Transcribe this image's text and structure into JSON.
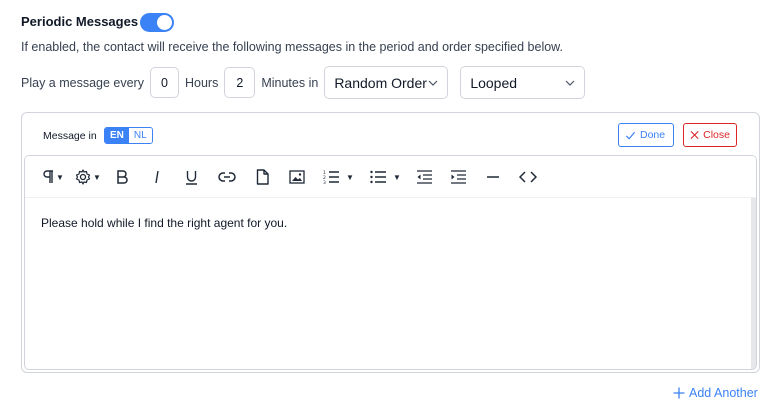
{
  "settings": {
    "title": "Periodic Messages",
    "enabled": true,
    "description": "If enabled, the contact will receive the following messages in the period and order specified below.",
    "schedule": {
      "prefix": "Play a message every",
      "hours_value": "0",
      "hours_label": "Hours",
      "minutes_value": "2",
      "minutes_label": "Minutes in",
      "order_selected": "Random Order",
      "loop_selected": "Looped"
    }
  },
  "message_panel": {
    "lang_label": "Message in",
    "languages": [
      "EN",
      "NL"
    ],
    "active_language": "EN",
    "done_label": "Done",
    "close_label": "Close",
    "content": "Please hold while I find the right agent for you."
  },
  "toolbar_icons": [
    "paragraph-icon",
    "gear-icon",
    "bold-icon",
    "italic-icon",
    "underline-icon",
    "link-icon",
    "file-icon",
    "image-icon",
    "ordered-list-icon",
    "unordered-list-icon",
    "outdent-icon",
    "indent-icon",
    "horizontal-rule-icon",
    "code-icon"
  ],
  "add_another_label": "Add Another",
  "colors": {
    "accent": "#3b82f6",
    "danger": "#dc2626",
    "border": "#d1d5db"
  }
}
